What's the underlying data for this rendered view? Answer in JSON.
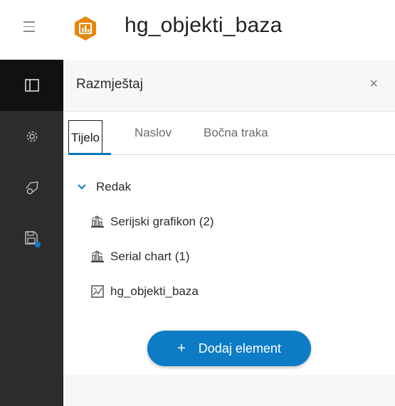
{
  "app": {
    "title": "hg_objekti_baza"
  },
  "panel": {
    "title": "Razmještaj",
    "close_glyph": "×",
    "tabs": [
      {
        "label": "Tijelo",
        "active": true
      },
      {
        "label": "Naslov",
        "active": false
      },
      {
        "label": "Bočna traka",
        "active": false
      }
    ],
    "tree": {
      "group_label": "Redak",
      "items": [
        {
          "label": "Serijski grafikon (2)",
          "icon": "chart-widget-icon"
        },
        {
          "label": "Serial chart (1)",
          "icon": "chart-widget-icon"
        },
        {
          "label": "hg_objekti_baza",
          "icon": "map-widget-icon"
        }
      ]
    },
    "add_button": {
      "plus": "+",
      "label": "Dodaj element"
    }
  },
  "rail": {
    "items": [
      "layout-icon",
      "settings-icon",
      "theme-icon",
      "save-icon"
    ],
    "save_badge_color": "#0d7cc5"
  },
  "colors": {
    "accent": "#0d7cc5",
    "rail_bg": "#2c2c2c",
    "logo": "#e8850c"
  }
}
